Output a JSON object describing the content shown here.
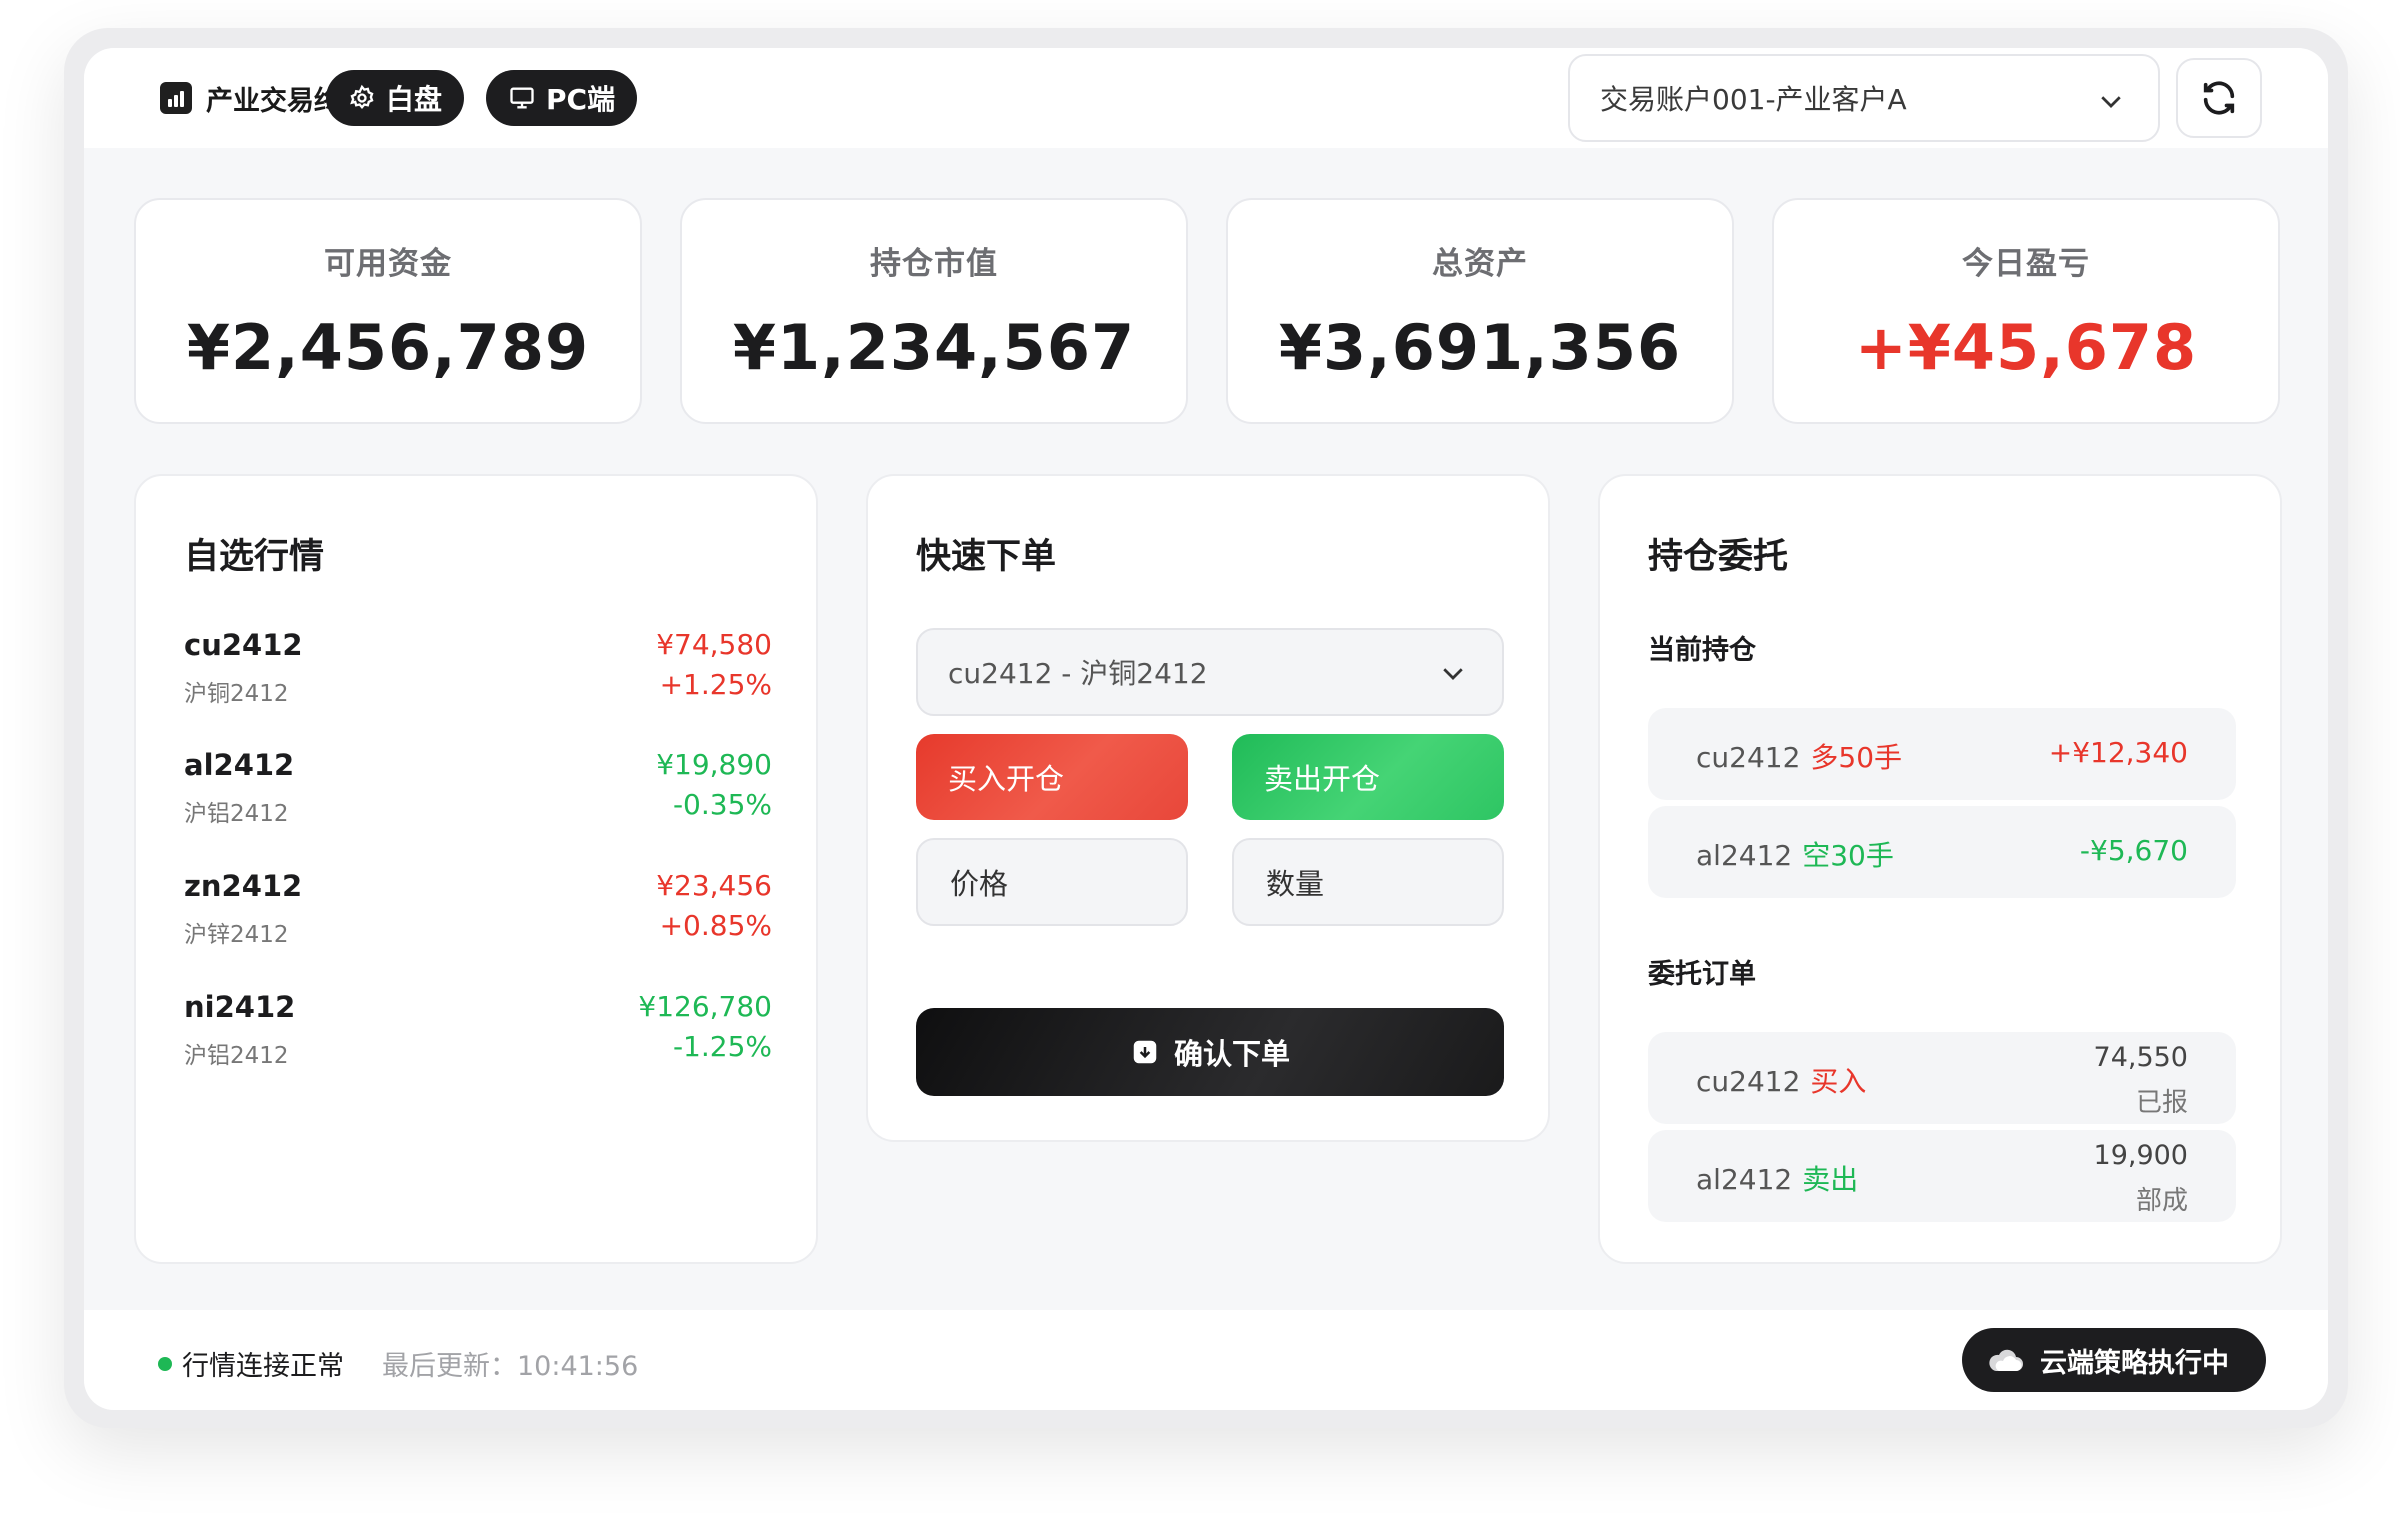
{
  "header": {
    "app_title": "产业交易终端",
    "theme_label": "白盘",
    "platform_label": "PC端",
    "account_selected": "交易账户001-产业客户A"
  },
  "stats": [
    {
      "label": "可用资金",
      "value": "¥2,456,789"
    },
    {
      "label": "持仓市值",
      "value": "¥1,234,567"
    },
    {
      "label": "总资产",
      "value": "¥3,691,356"
    },
    {
      "label": "今日盈亏",
      "value": "+¥45,678"
    }
  ],
  "watchlist": {
    "title": "自选行情",
    "items": [
      {
        "code": "cu2412",
        "name": "沪铜2412",
        "price": "¥74,580",
        "change": "+1.25%",
        "trend": "up"
      },
      {
        "code": "al2412",
        "name": "沪铝2412",
        "price": "¥19,890",
        "change": "-0.35%",
        "trend": "down"
      },
      {
        "code": "zn2412",
        "name": "沪锌2412",
        "price": "¥23,456",
        "change": "+0.85%",
        "trend": "up"
      },
      {
        "code": "ni2412",
        "name": "沪铝2412",
        "price": "¥126,780",
        "change": "-1.25%",
        "trend": "down"
      }
    ]
  },
  "order": {
    "title": "快速下单",
    "contract_selected": "cu2412 - 沪铜2412",
    "buy_label": "买入开仓",
    "sell_label": "卖出开仓",
    "price_placeholder": "价格",
    "qty_placeholder": "数量",
    "submit_label": "确认下单"
  },
  "positions": {
    "title": "持仓委托",
    "holdings_title": "当前持仓",
    "holdings": [
      {
        "code": "cu2412",
        "side": "多50手",
        "pnl": "+¥12,340",
        "trend": "up"
      },
      {
        "code": "al2412",
        "side": "空30手",
        "pnl": "-¥5,670",
        "trend": "down"
      }
    ],
    "orders_title": "委托订单",
    "orders": [
      {
        "code": "cu2412",
        "side": "买入",
        "price": "74,550",
        "status": "已报",
        "trend": "up"
      },
      {
        "code": "al2412",
        "side": "卖出",
        "price": "19,900",
        "status": "部成",
        "trend": "down"
      }
    ]
  },
  "footer": {
    "connection": "行情连接正常",
    "last_update": "最后更新：10:41:56",
    "cloud_status": "云端策略执行中"
  },
  "colors": {
    "up": "#e8362b",
    "down": "#1eb855",
    "dark": "#1d1d1f"
  }
}
